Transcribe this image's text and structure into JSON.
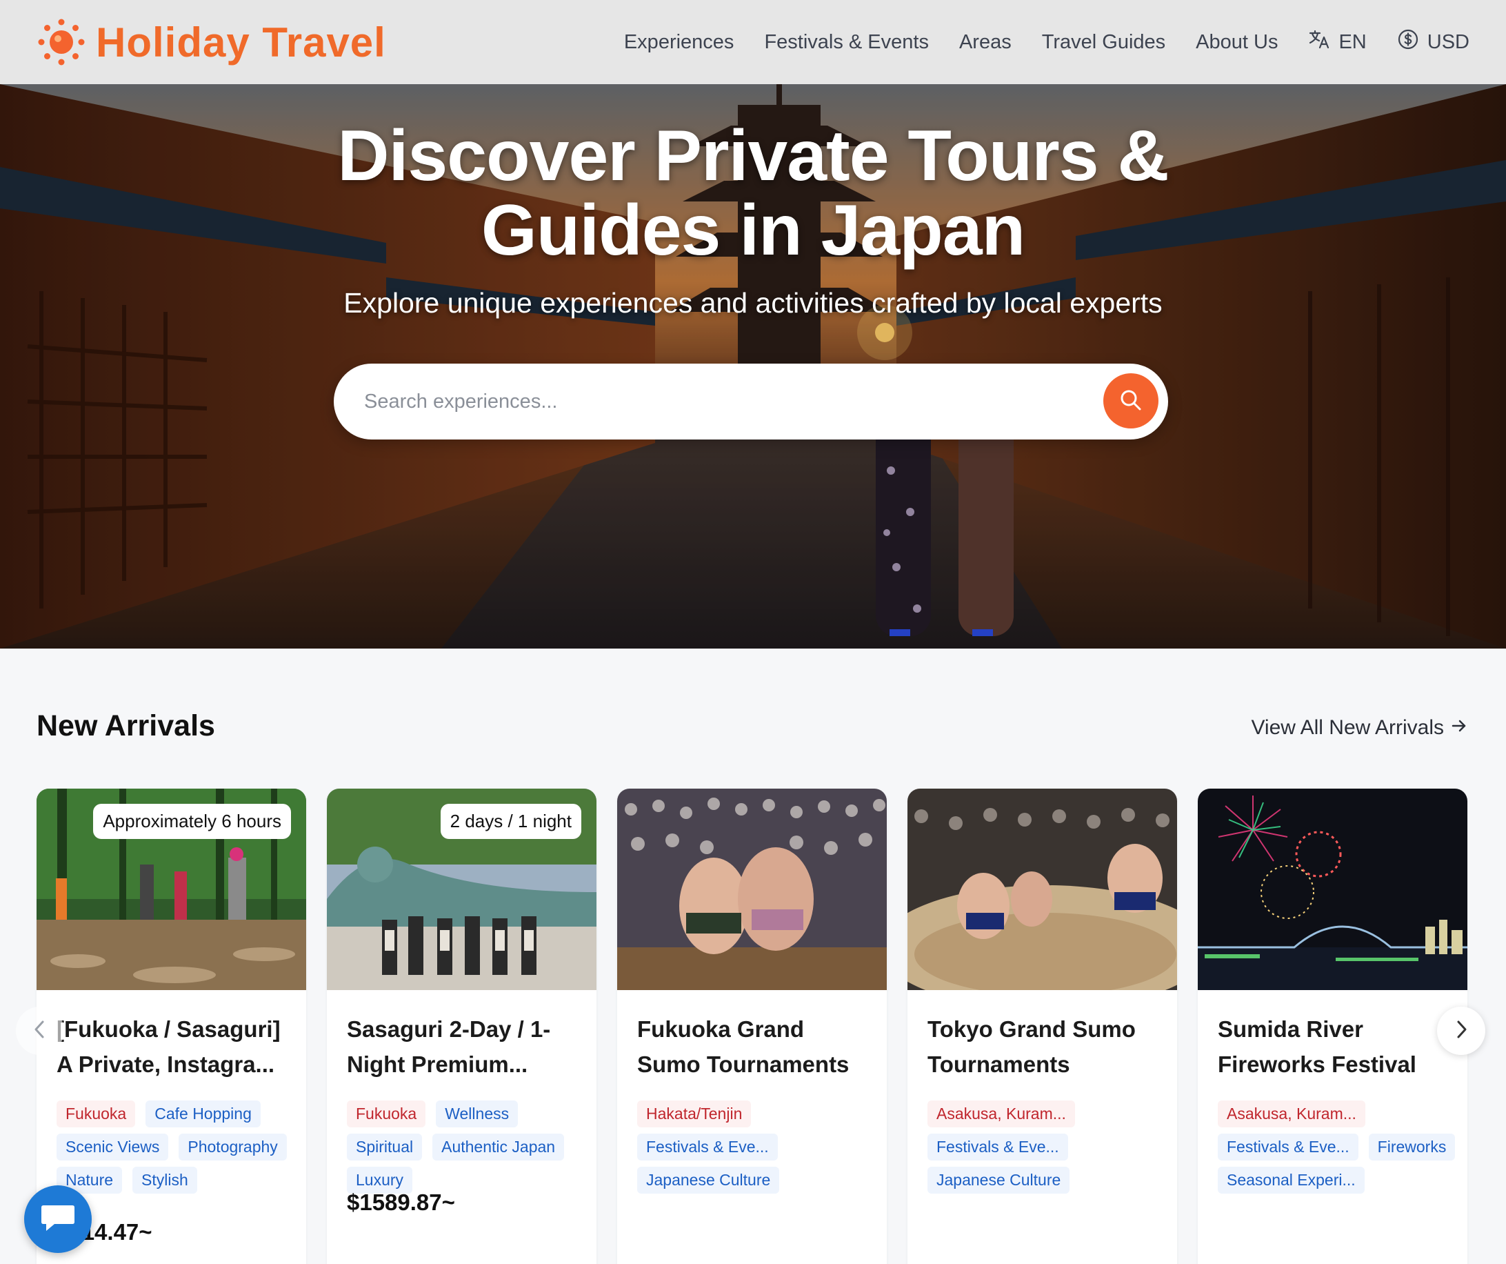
{
  "brand": {
    "name": "Holiday Travel",
    "accent": "#f06a2a"
  },
  "nav": {
    "items": [
      "Experiences",
      "Festivals & Events",
      "Areas",
      "Travel Guides",
      "About Us"
    ],
    "language": "EN",
    "currency": "USD"
  },
  "hero": {
    "title_line1": "Discover Private Tours &",
    "title_line2": "Guides in Japan",
    "subtitle": "Explore unique experiences and activities crafted by local experts",
    "search_placeholder": "Search experiences..."
  },
  "section": {
    "title": "New Arrivals",
    "view_all": "View All New Arrivals",
    "cards": [
      {
        "badge": "Approximately 6 hours",
        "title": "[Fukuoka / Sasaguri] A Private, Instagra...",
        "tags_location": [
          "Fukuoka"
        ],
        "tags_category": [
          "Cafe Hopping",
          "Scenic Views",
          "Photography",
          "Nature",
          "Stylish"
        ],
        "price": "$214.47~"
      },
      {
        "badge": "2 days / 1 night",
        "title": "Sasaguri 2-Day / 1-Night Premium...",
        "tags_location": [
          "Fukuoka"
        ],
        "tags_category": [
          "Wellness",
          "Spiritual",
          "Authentic Japan",
          "Luxury"
        ],
        "price": "$1589.87~"
      },
      {
        "badge": "",
        "title": "Fukuoka Grand Sumo Tournaments",
        "tags_location": [
          "Hakata/Tenjin"
        ],
        "tags_category": [
          "Festivals & Eve...",
          "Japanese Culture"
        ],
        "price": ""
      },
      {
        "badge": "",
        "title": "Tokyo Grand Sumo Tournaments",
        "tags_location": [
          "Asakusa, Kuram..."
        ],
        "tags_category": [
          "Festivals & Eve...",
          "Japanese Culture"
        ],
        "price": ""
      },
      {
        "badge": "",
        "title": "Sumida River Fireworks Festival",
        "tags_location": [
          "Asakusa, Kuram..."
        ],
        "tags_category": [
          "Festivals & Eve...",
          "Fireworks",
          "Seasonal Experi..."
        ],
        "price": ""
      }
    ]
  },
  "icons": [
    "sun-logo-icon",
    "translate-icon",
    "dollar-circle-icon",
    "search-icon",
    "arrow-right-icon",
    "chevron-left-icon",
    "chevron-right-icon",
    "chat-icon"
  ]
}
